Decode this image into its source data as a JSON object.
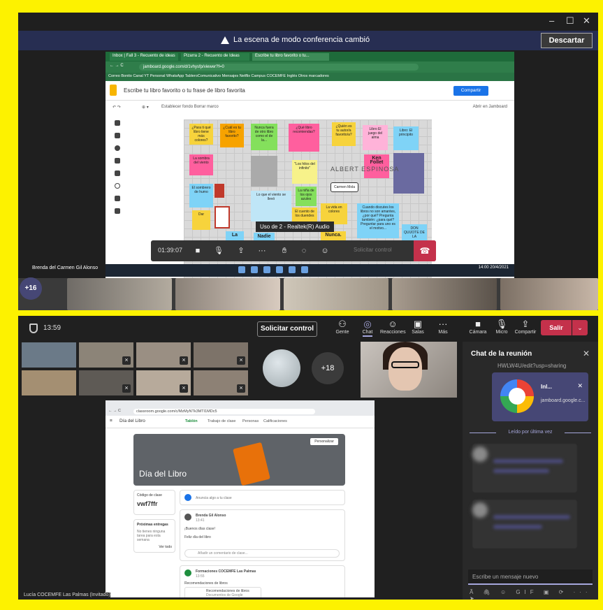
{
  "top": {
    "banner": {
      "message": "La escena de modo conferencia cambió",
      "dismiss": "Descartar"
    },
    "window_controls": [
      "–",
      "☐",
      "✕"
    ],
    "browser": {
      "tabs": [
        "Inbox | Fall 3 - Recuento de ideas",
        "Pizarra 2 - Recuento de Ideas",
        "Escribe tu libro favorito o tu..."
      ],
      "url": "jamboard.google.com/d/1vhysfp/viewer?f=0",
      "bookmarks": "Correo Bonito    Canal YT Personal    WhatsApp    TableroComunicativo    Mensajes    Netflix    Campus COCEMFE    Inglés    Otros marcadores"
    },
    "jamboard": {
      "title": "Escribe tu libro favorito o tu frase de libro favorita",
      "share": "Compartir",
      "tools_left": "Establecer fondo    Borrar marco",
      "open_in": "Abrir en Jamboard",
      "notes": [
        "¿Para ti qué libro tiene más colores?",
        "¿Cuál es tu libro favorito?",
        "Nunca fuera de otro libro como el de la...",
        "¿Qué libro recomiendas?",
        "¿Quién es tu autor/a favorito/a?",
        "Libro El juego del alma",
        "Libro: El principito",
        "La sombra del viento",
        "\"Los hilos del infinito\"",
        "Ken Follet",
        "El sombrero de humo",
        "La vida en colores",
        "Lo que el viento se llevó",
        "La niña de los ojos azules",
        "El cuento de los duendes",
        "Cuando discutes los libros no son amantes, ¿por qué? Pregunta también: ¿para qué? Preguntar para uno es el motivo...",
        "DON QUIJOTE DE LA",
        "Nadie",
        "Nunca.",
        "La",
        "Dar"
      ],
      "author_text": "ALBERT ESPINOSA",
      "name_box": "Carmen Mola"
    },
    "call": {
      "timer": "01:39:07",
      "request_control": "Solicitar control",
      "audio_tip": "Uso de 2 - Realtek(R) Audio"
    },
    "presenter": "Brenda del Carmen Gil Alonso",
    "taskbar_time": "14:00\n20/4/2021",
    "overflow": "+16"
  },
  "bottom": {
    "clock": "13:59",
    "request_control": "Solicitar control",
    "toolbar": [
      {
        "icon": "people-icon",
        "label": "Gente"
      },
      {
        "icon": "chat-icon",
        "label": "Chat"
      },
      {
        "icon": "reactions-icon",
        "label": "Reacciones"
      },
      {
        "icon": "rooms-icon",
        "label": "Salas"
      },
      {
        "icon": "more-icon",
        "label": "Más"
      },
      {
        "icon": "camera-icon",
        "label": "Cámara"
      },
      {
        "icon": "mic-icon",
        "label": "Micro"
      },
      {
        "icon": "share-icon",
        "label": "Compartir"
      }
    ],
    "leave": "Salir",
    "overflow": "+18",
    "classroom": {
      "url": "classroom.google.com/c/MzMyNTk3MTI1MDc5",
      "app_title": "Día del Libro",
      "tabs": [
        "Tablón",
        "Trabajo de clase",
        "Personas",
        "Calificaciones"
      ],
      "banner_title": "Día del Libro",
      "customize": "Personalizar",
      "class_code_label": "Código de clase",
      "class_code": "vwf7ffr",
      "upcoming_title": "Próximas entregas",
      "upcoming_text": "No tienes ninguna tarea para esta semana",
      "view_all": "Ver todo",
      "announce_placeholder": "Anuncia algo a tu clase",
      "post1_author": "Brenda Gil Alonso",
      "post1_time": "13:41",
      "post1_line1": "¡Buenos días clase!",
      "post1_line2": "Feliz día del libro",
      "comment_placeholder": "Añadir un comentario de clase...",
      "post2_author": "Formaciones COCEMFE Las Palmas",
      "post2_time": "13:55",
      "post2_line1": "Recomendaciones de libros",
      "post2_attach": "Recomendaciones de libros",
      "post2_attach_sub": "Documentos de Google"
    },
    "participant_label": "Lucía COCEMFE Las Palmas (Invitado)",
    "chat": {
      "title": "Chat de la reunión",
      "link_text": "HWLW4U/edit?usp=sharing",
      "card_title": "Inl...",
      "card_domain": "jamboard.google.c...",
      "read_label": "Leído por última vez",
      "input_placeholder": "Escribe un mensaje nuevo",
      "tools": "A᷉ 🖇 ☺ GIF ▣ ⟳ ···   ➤"
    }
  }
}
